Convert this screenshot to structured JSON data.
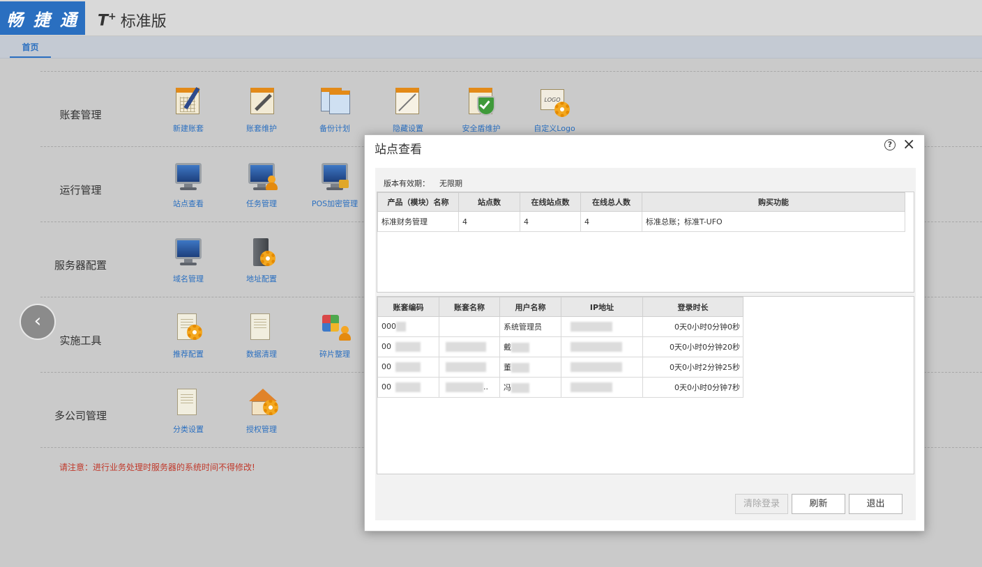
{
  "header": {
    "brand": "畅 捷 通",
    "product_prefix": "T",
    "product_sup": "+",
    "product_name": "标准版"
  },
  "tabs": [
    {
      "label": "首页"
    }
  ],
  "sections": [
    {
      "title": "账套管理",
      "tools": [
        {
          "label": "新建账套",
          "icon": "new-book-icon"
        },
        {
          "label": "账套维护",
          "icon": "book-wrench-icon"
        },
        {
          "label": "备份计划",
          "icon": "backup-plan-icon"
        },
        {
          "label": "隐藏设置",
          "icon": "hide-settings-icon"
        },
        {
          "label": "安全盾维护",
          "icon": "shield-icon"
        },
        {
          "label": "自定义Logo",
          "icon": "logo-gear-icon"
        }
      ]
    },
    {
      "title": "运行管理",
      "tools": [
        {
          "label": "站点查看",
          "icon": "monitor-icon"
        },
        {
          "label": "任务管理",
          "icon": "monitor-user-icon"
        },
        {
          "label": "POS加密管理",
          "icon": "monitor-lock-icon"
        }
      ]
    },
    {
      "title": "服务器配置",
      "tools": [
        {
          "label": "域名管理",
          "icon": "monitor-icon"
        },
        {
          "label": "地址配置",
          "icon": "server-gear-icon"
        }
      ]
    },
    {
      "title": "实施工具",
      "tools": [
        {
          "label": "推荐配置",
          "icon": "doc-gear-icon"
        },
        {
          "label": "数据清理",
          "icon": "doc-icon"
        },
        {
          "label": "碎片整理",
          "icon": "pieces-user-icon"
        }
      ]
    },
    {
      "title": "多公司管理",
      "tools": [
        {
          "label": "分类设置",
          "icon": "doc-icon"
        },
        {
          "label": "授权管理",
          "icon": "house-gear-icon"
        }
      ]
    }
  ],
  "notice": "请注意：进行业务处理时服务器的系统时间不得修改!",
  "back_button": "‹",
  "dialog": {
    "title": "站点查看",
    "help": "?",
    "close": "×",
    "version_label": "版本有效期：",
    "version_value": "无限期",
    "table1": {
      "headers": [
        "产品（模块）名称",
        "站点数",
        "在线站点数",
        "在线总人数",
        "购买功能"
      ],
      "rows": [
        [
          "标准财务管理",
          "4",
          "4",
          "4",
          "标准总账；标准T-UFO"
        ]
      ]
    },
    "table2": {
      "headers": [
        "账套编码",
        "账套名称",
        "用户名称",
        "IP地址",
        "登录时长"
      ],
      "rows": [
        [
          "000",
          "",
          "系统管理员",
          "",
          "0天0小时0分钟0秒"
        ],
        [
          "00",
          "",
          "戴",
          "",
          "0天0小时0分钟20秒"
        ],
        [
          "00",
          "",
          "董",
          "",
          "0天0小时2分钟25秒"
        ],
        [
          "00",
          "..",
          "冯",
          "",
          "0天0小时0分钟7秒"
        ]
      ]
    },
    "buttons": {
      "clear": "清除登录",
      "refresh": "刷新",
      "exit": "退出"
    }
  },
  "colors": {
    "brand": "#2a6fc0",
    "notice": "#c0392b"
  }
}
